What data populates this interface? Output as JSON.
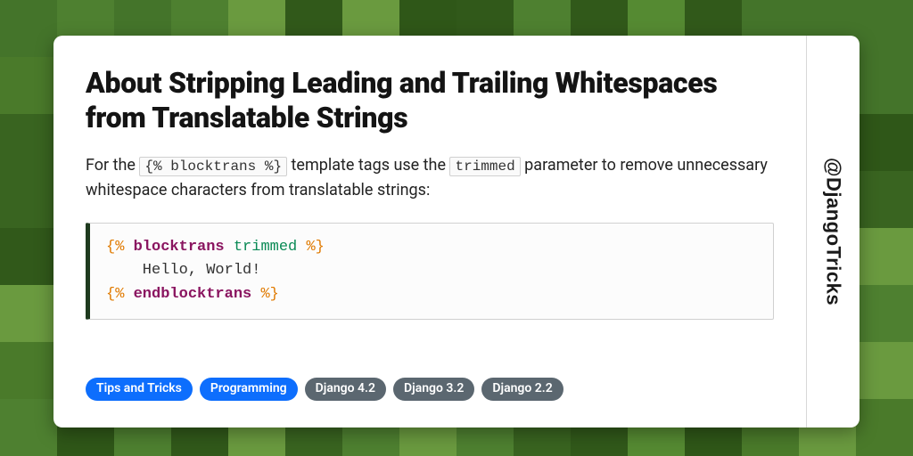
{
  "handle": "@DjangoTricks",
  "title": "About Stripping Leading and Trailing Whitespaces from Translatable Strings",
  "desc": {
    "part1": "For the ",
    "code1": "{% blocktrans %}",
    "part2": " template tags use the ",
    "code2": "trimmed",
    "part3": " parameter to remove unnecessary whitespace characters from translatable strings:"
  },
  "code": {
    "open_tag_l": "{%",
    "open_kw": "blocktrans",
    "open_param": "trimmed",
    "open_tag_r": "%}",
    "body": "    Hello, World!",
    "close_tag_l": "{%",
    "close_kw": "endblocktrans",
    "close_tag_r": "%}"
  },
  "tags": [
    {
      "label": "Tips and Tricks",
      "variant": "primary"
    },
    {
      "label": "Programming",
      "variant": "primary"
    },
    {
      "label": "Django 4.2",
      "variant": "secondary"
    },
    {
      "label": "Django 3.2",
      "variant": "secondary"
    },
    {
      "label": "Django 2.2",
      "variant": "secondary"
    }
  ],
  "bg_palette": [
    "#2f5718",
    "#4a7a2a",
    "#558a32",
    "#396420",
    "#6a9a3f",
    "#31591a",
    "#4e8030",
    "#44742a"
  ]
}
